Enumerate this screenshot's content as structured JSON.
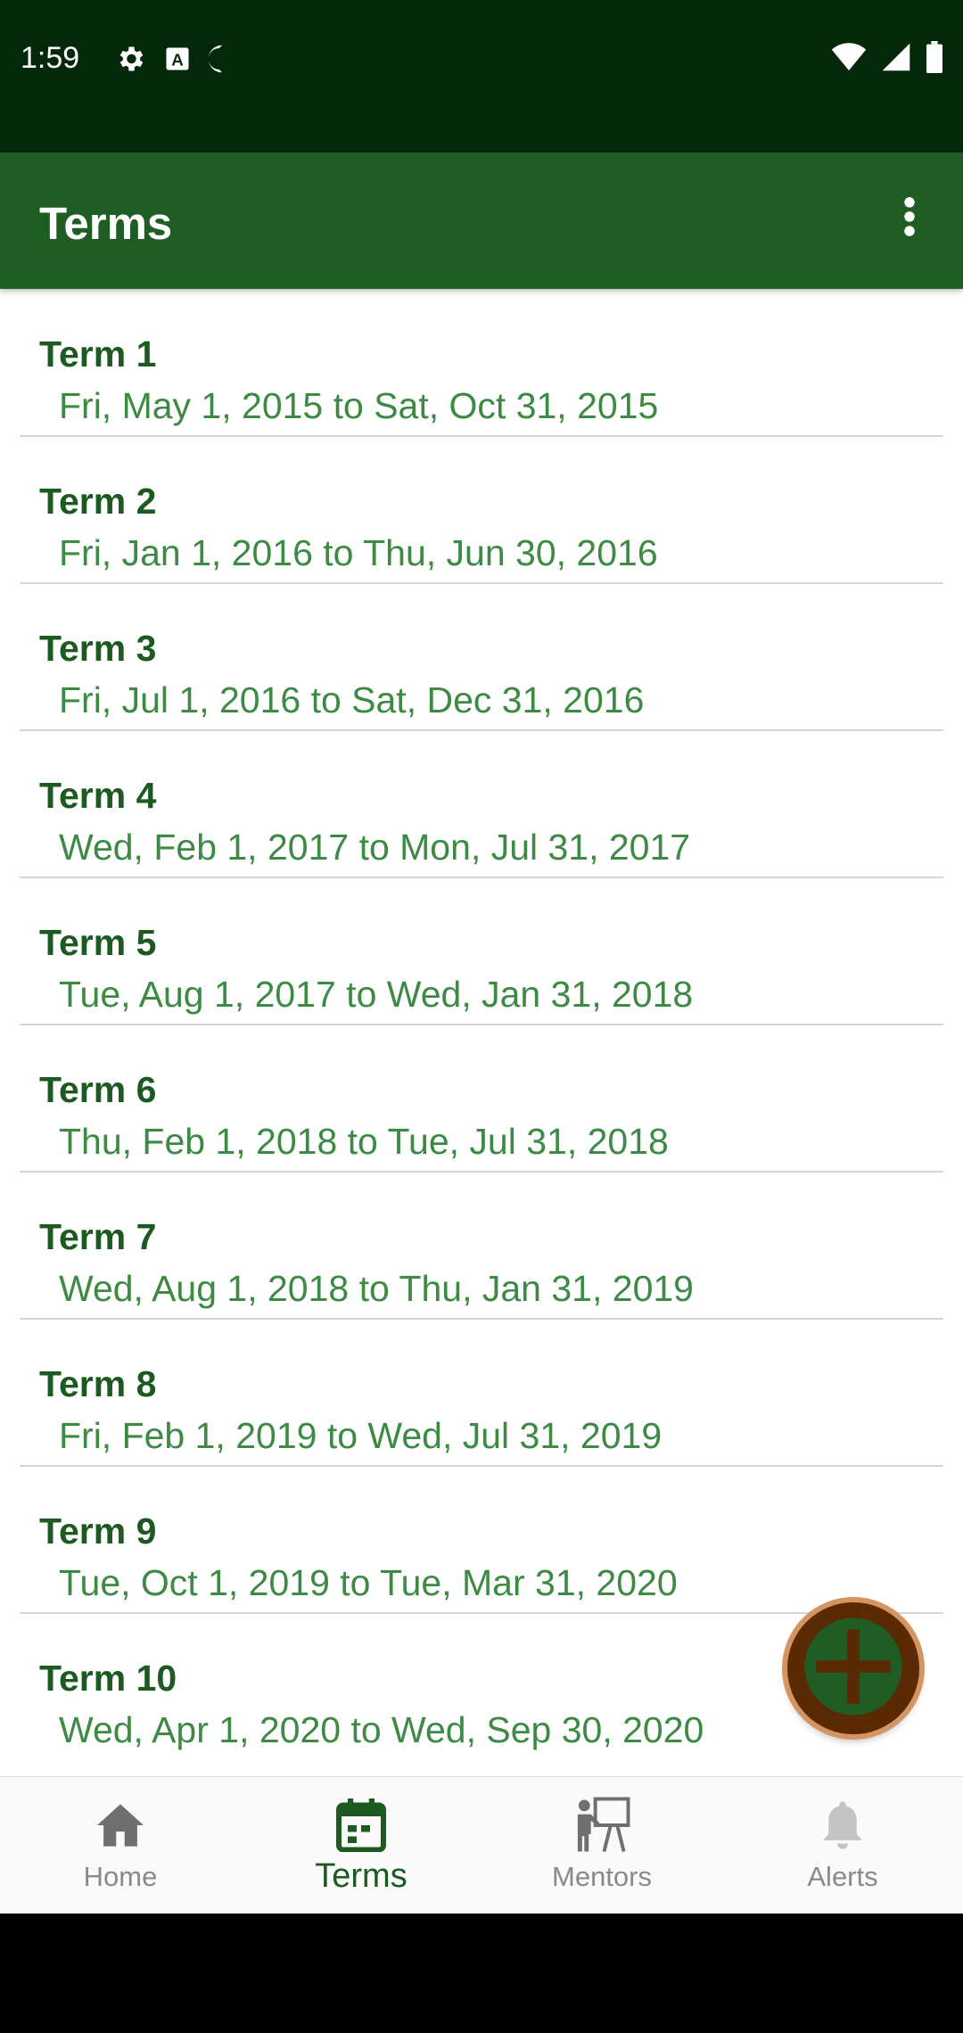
{
  "status_bar": {
    "time": "1:59",
    "left_icons": [
      "gear-icon",
      "a-badge-icon",
      "half-circle-icon"
    ],
    "right_icons": [
      "wifi-icon",
      "signal-icon",
      "battery-icon"
    ]
  },
  "app_bar": {
    "title": "Terms",
    "menu_icon": "more-vert-icon"
  },
  "terms": [
    {
      "name": "Term 1",
      "dates": "Fri, May 1, 2015 to Sat, Oct 31, 2015"
    },
    {
      "name": "Term 2",
      "dates": "Fri, Jan 1, 2016 to Thu, Jun 30, 2016"
    },
    {
      "name": "Term 3",
      "dates": "Fri, Jul 1, 2016 to Sat, Dec 31, 2016"
    },
    {
      "name": "Term 4",
      "dates": "Wed, Feb 1, 2017 to Mon, Jul 31, 2017"
    },
    {
      "name": "Term 5",
      "dates": "Tue, Aug 1, 2017 to Wed, Jan 31, 2018"
    },
    {
      "name": "Term 6",
      "dates": "Thu, Feb 1, 2018 to Tue, Jul 31, 2018"
    },
    {
      "name": "Term 7",
      "dates": "Wed, Aug 1, 2018 to Thu, Jan 31, 2019"
    },
    {
      "name": "Term 8",
      "dates": "Fri, Feb 1, 2019 to Wed, Jul 31, 2019"
    },
    {
      "name": "Term 9",
      "dates": "Tue, Oct 1, 2019 to Tue, Mar 31, 2020"
    },
    {
      "name": "Term 10",
      "dates": "Wed, Apr 1, 2020 to Wed, Sep 30, 2020"
    }
  ],
  "fab": {
    "icon": "plus-icon"
  },
  "bottom_nav": [
    {
      "label": "Home",
      "icon": "home-icon",
      "active": false
    },
    {
      "label": "Terms",
      "icon": "calendar-icon",
      "active": true
    },
    {
      "label": "Mentors",
      "icon": "mentor-icon",
      "active": false
    },
    {
      "label": "Alerts",
      "icon": "bell-icon",
      "active": false
    }
  ],
  "colors": {
    "status_bar": "#04290a",
    "app_bar": "#1f5d24",
    "term_name": "#1c5a22",
    "term_dates": "#3d8a44",
    "fab": "#5a2a05",
    "fab_ring": "#d49563",
    "nav_inactive": "#8a8a8a"
  }
}
